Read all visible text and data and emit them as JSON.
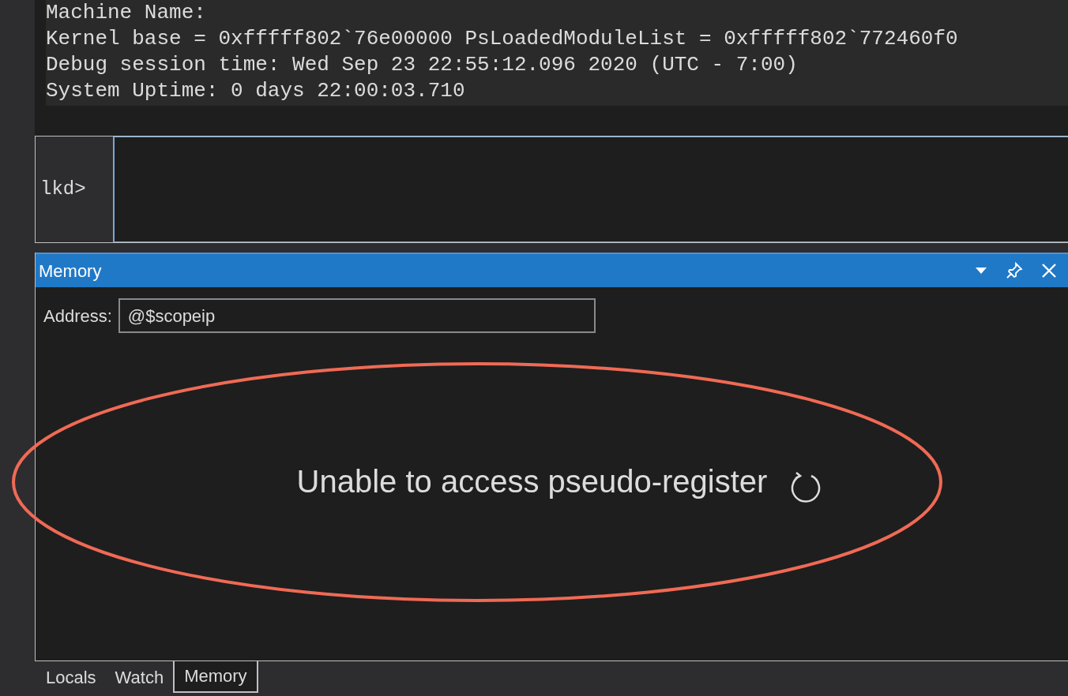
{
  "output": {
    "lines": [
      "Machine Name:",
      "Kernel base = 0xfffff802`76e00000 PsLoadedModuleList = 0xfffff802`772460f0",
      "Debug session time: Wed Sep 23 22:55:12.096 2020 (UTC - 7:00)",
      "System Uptime: 0 days 22:00:03.710"
    ]
  },
  "command": {
    "prompt": "lkd>"
  },
  "memory_panel": {
    "title": "Memory",
    "address_label": "Address:",
    "address_value": "@$scopeip",
    "message": "Unable to access pseudo-register",
    "annotation": true
  },
  "tabs": [
    {
      "label": "Locals",
      "selected": false
    },
    {
      "label": "Watch",
      "selected": false
    },
    {
      "label": "Memory",
      "selected": true
    }
  ]
}
